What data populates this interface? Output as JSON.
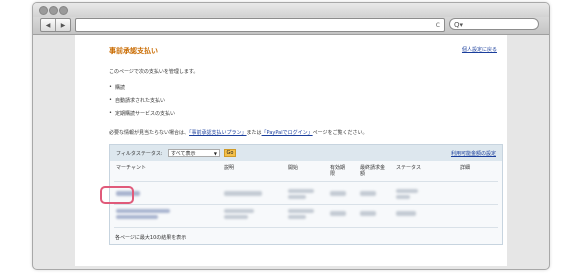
{
  "browser": {
    "back_glyph": "◀",
    "forward_glyph": "▶",
    "reload_glyph": "c",
    "search_glyph": "Q▾"
  },
  "page": {
    "title": "事前承認支払い",
    "setting_link": "個人設定に戻る",
    "description": "このページで次の支払いを管理します。",
    "bullets": [
      "購読",
      "自動請求された支払い",
      "定期購読サービスの支払い"
    ],
    "help": {
      "prefix": "必要な情報が見当たらない場合は、",
      "link1": "「事前承認支払いプラン」",
      "middle": "または",
      "link2": "「PayPalでログイン」",
      "suffix": "ページをご覧ください。"
    }
  },
  "table": {
    "filter_label": "フィルタステータス:",
    "filter_value": "すべて表示",
    "go_label": "Go",
    "manage_link": "利用可能金額の設定",
    "headers": {
      "merchant": "マーチャント",
      "description": "説明",
      "start": "開始",
      "expiry": "有効期\n限",
      "max_amount": "最終請求金\n額",
      "status": "ステータス",
      "details": "詳細"
    },
    "footer": "各ページに最大10の結果を表示"
  },
  "colors": {
    "title": "#c96b00",
    "link": "#1a3e9c",
    "highlight": "#e05a7a",
    "go_button": "#f5c04a"
  }
}
